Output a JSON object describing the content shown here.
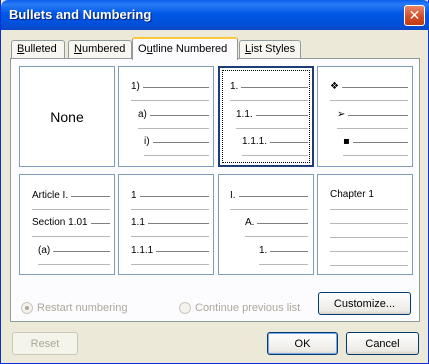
{
  "dialog": {
    "title": "Bullets and Numbering"
  },
  "tabs": [
    {
      "label_pre": "",
      "label_key": "B",
      "label_post": "ulleted"
    },
    {
      "label_pre": "",
      "label_key": "N",
      "label_post": "umbered"
    },
    {
      "label_pre": "O",
      "label_key": "u",
      "label_post": "tline Numbered"
    },
    {
      "label_pre": "",
      "label_key": "L",
      "label_post": "ist Styles"
    }
  ],
  "gallery": {
    "none_label": "None",
    "tile2": [
      "1)",
      "a)",
      "i)"
    ],
    "tile3": [
      "1.",
      "1.1.",
      "1.1.1."
    ],
    "tile4": [
      "❖",
      "➢",
      "▪"
    ],
    "tile5": [
      "Article I.",
      "Section 1.01",
      "(a)"
    ],
    "tile6": [
      "1",
      "1.1",
      "1.1.1"
    ],
    "tile7": [
      "I.",
      "A.",
      "1."
    ],
    "tile8": [
      "Chapter 1"
    ]
  },
  "options": {
    "restart_label": "Restart numbering",
    "continue_label": "Continue previous list"
  },
  "buttons": {
    "customize_label": "Customize...",
    "reset_label": "Reset",
    "ok_label": "OK",
    "cancel_label": "Cancel"
  }
}
